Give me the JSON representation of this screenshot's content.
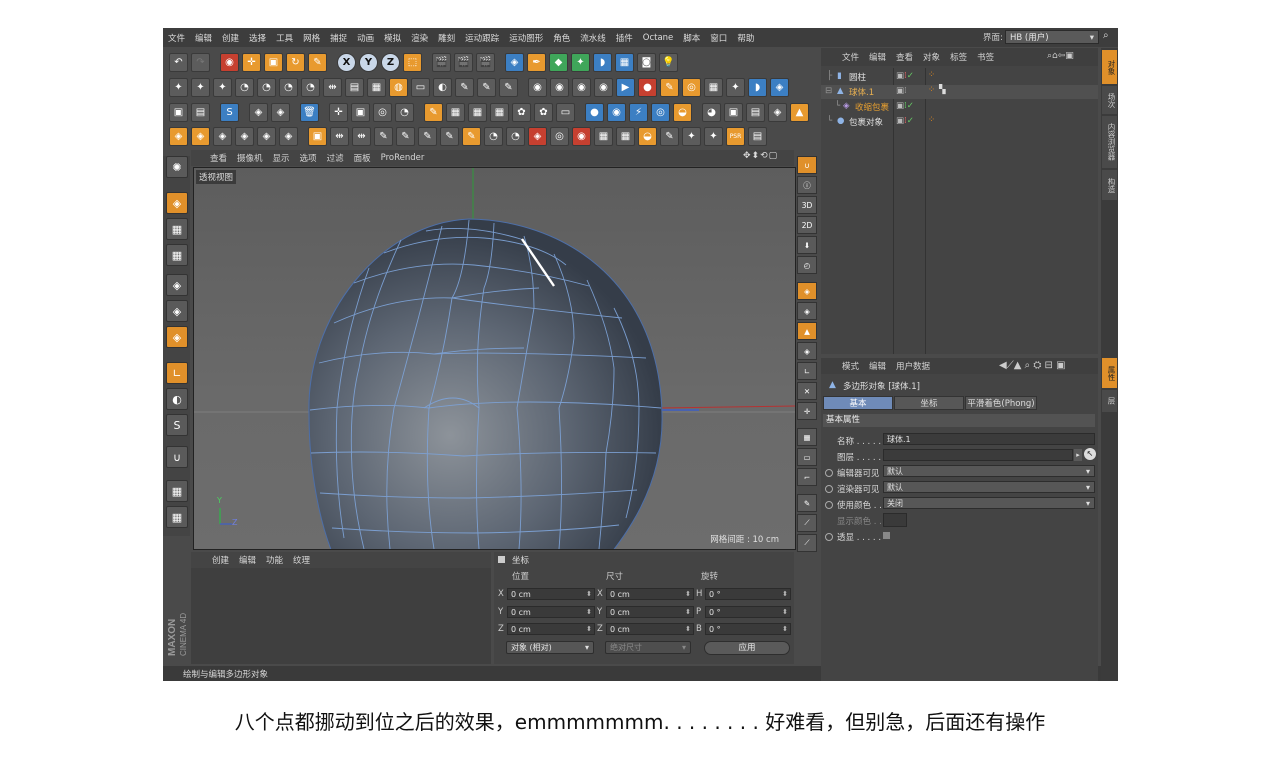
{
  "menu": [
    "文件",
    "编辑",
    "创建",
    "选择",
    "工具",
    "网格",
    "捕捉",
    "动画",
    "模拟",
    "渲染",
    "雕刻",
    "运动跟踪",
    "运动图形",
    "角色",
    "流水线",
    "插件",
    "Octane",
    "脚本",
    "窗口",
    "帮助"
  ],
  "ui_label": "界面:",
  "layout_value": "HB (用户)",
  "viewport": {
    "menu": [
      "查看",
      "摄像机",
      "显示",
      "选项",
      "过滤",
      "面板",
      "ProRender"
    ],
    "label": "透视视图",
    "grid_readout": "网格间距 : 10 cm",
    "axis_y": "Y",
    "axis_z": "Z"
  },
  "material_panel": {
    "menu": [
      "创建",
      "编辑",
      "功能",
      "纹理"
    ]
  },
  "coords": {
    "title": "坐标",
    "headers": [
      "位置",
      "尺寸",
      "旋转"
    ],
    "rows": [
      {
        "l1": "X",
        "v1": "0 cm",
        "l2": "X",
        "v2": "0 cm",
        "l3": "H",
        "v3": "0 °"
      },
      {
        "l1": "Y",
        "v1": "0 cm",
        "l2": "Y",
        "v2": "0 cm",
        "l3": "P",
        "v3": "0 °"
      },
      {
        "l1": "Z",
        "v1": "0 cm",
        "l2": "Z",
        "v2": "0 cm",
        "l3": "B",
        "v3": "0 °"
      }
    ],
    "mode": "对象 (相对)",
    "size_mode": "绝对尺寸",
    "apply": "应用"
  },
  "status": "绘制与编辑多边形对象",
  "objects": {
    "menu": [
      "文件",
      "编辑",
      "查看",
      "对象",
      "标签",
      "书签"
    ],
    "items": [
      {
        "name": "圆柱",
        "color": "#dcdcdc"
      },
      {
        "name": "球体.1",
        "color": "#e8b050"
      },
      {
        "name": "收缩包裹",
        "color": "#e8a030"
      },
      {
        "name": "包裹对象",
        "color": "#dcdcdc"
      }
    ]
  },
  "attributes": {
    "menu": [
      "模式",
      "编辑",
      "用户数据"
    ],
    "title": "多边形对象 [球体.1]",
    "tabs": [
      "基本",
      "坐标",
      "平滑着色(Phong)"
    ],
    "section": "基本属性",
    "name_label": "名称 . . . . .",
    "name_value": "球体.1",
    "layer_label": "图层 . . . . .",
    "editor_vis_label": "编辑器可见",
    "editor_vis_value": "默认",
    "render_vis_label": "渲染器可见",
    "render_vis_value": "默认",
    "use_color_label": "使用颜色 . .",
    "use_color_value": "关闭",
    "display_color_label": "显示颜色 . .",
    "xray_label": "透显 . . . . ."
  },
  "side_tabs": [
    "对象",
    "场次",
    "内容浏览器",
    "构造",
    "属性",
    "层"
  ],
  "logo": {
    "brand": "MAXON",
    "product": "CINEMA 4D"
  },
  "caption": "八个点都挪动到位之后的效果，emmmmmmm. . . . . . . . 好难看，但别急，后面还有操作"
}
